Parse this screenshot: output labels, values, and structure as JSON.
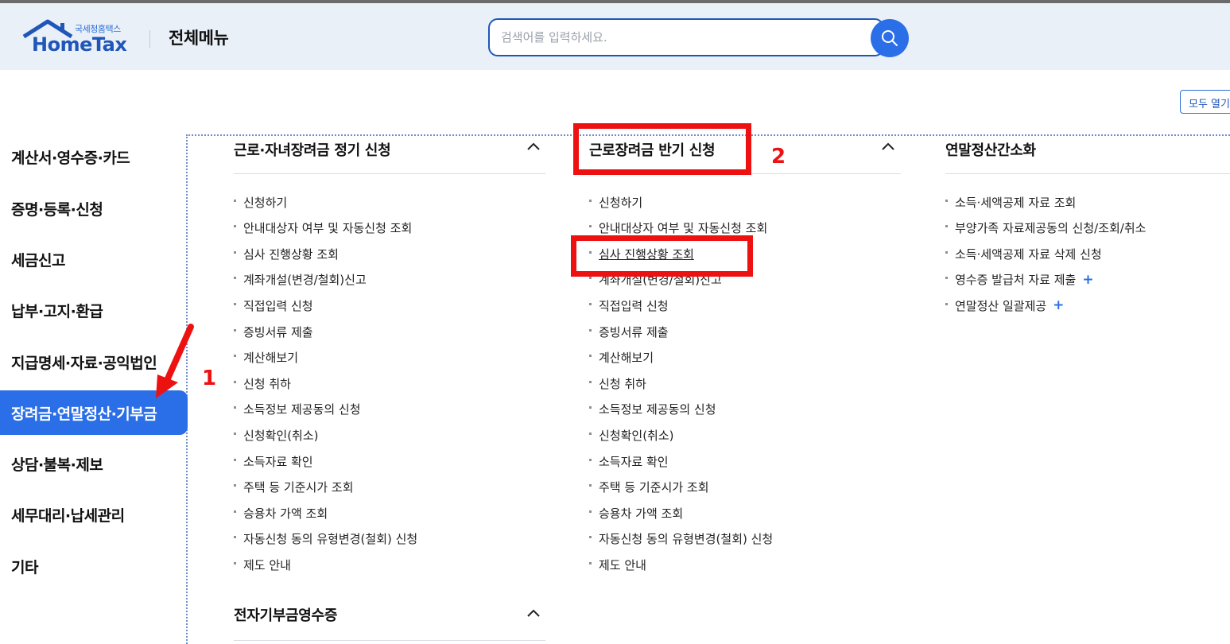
{
  "header": {
    "logo_sub": "국세청홈택스",
    "logo_main": "HomeTax",
    "title": "전체메뉴",
    "search_placeholder": "검색어를 입력하세요.",
    "brand_color": "#2b6fe8"
  },
  "expand_all_label": "모두 열기",
  "sidebar": {
    "items": [
      {
        "label": "계산서·영수증·카드"
      },
      {
        "label": "증명·등록·신청"
      },
      {
        "label": "세금신고"
      },
      {
        "label": "납부·고지·환급"
      },
      {
        "label": "지급명세·자료·공익법인"
      },
      {
        "label": "장려금·연말정산·기부금",
        "active": true
      },
      {
        "label": "상담·불복·제보"
      },
      {
        "label": "세무대리·납세관리"
      },
      {
        "label": "기타"
      }
    ]
  },
  "columns": [
    {
      "title": "근로·자녀장려금 정기 신청",
      "items": [
        "신청하기",
        "안내대상자 여부 및 자동신청 조회",
        "심사 진행상황 조회",
        "계좌개설(변경/철회)신고",
        "직접입력 신청",
        "증빙서류 제출",
        "계산해보기",
        "신청 취하",
        "소득정보 제공동의 신청",
        "신청확인(취소)",
        "소득자료 확인",
        "주택 등 기준시가 조회",
        "승용차 가액 조회",
        "자동신청 동의 유형변경(철회) 신청",
        "제도 안내"
      ]
    },
    {
      "title": "근로장려금 반기 신청",
      "items": [
        "신청하기",
        "안내대상자 여부 및 자동신청 조회",
        "심사 진행상황 조회",
        "계좌개설(변경/철회)신고",
        "직접입력 신청",
        "증빙서류 제출",
        "계산해보기",
        "신청 취하",
        "소득정보 제공동의 신청",
        "신청확인(취소)",
        "소득자료 확인",
        "주택 등 기준시가 조회",
        "승용차 가액 조회",
        "자동신청 동의 유형변경(철회) 신청",
        "제도 안내"
      ]
    },
    {
      "title": "연말정산간소화",
      "items": [
        "소득·세액공제 자료 조회",
        "부양가족 자료제공동의 신청/조회/취소",
        "소득·세액공제 자료 삭제 신청",
        "영수증 발급처 자료 제출",
        "연말정산 일괄제공"
      ]
    }
  ],
  "second_section_title": "전자기부금영수증",
  "annotations": {
    "num1": "1",
    "num2": "2",
    "color": "#ee1111"
  }
}
